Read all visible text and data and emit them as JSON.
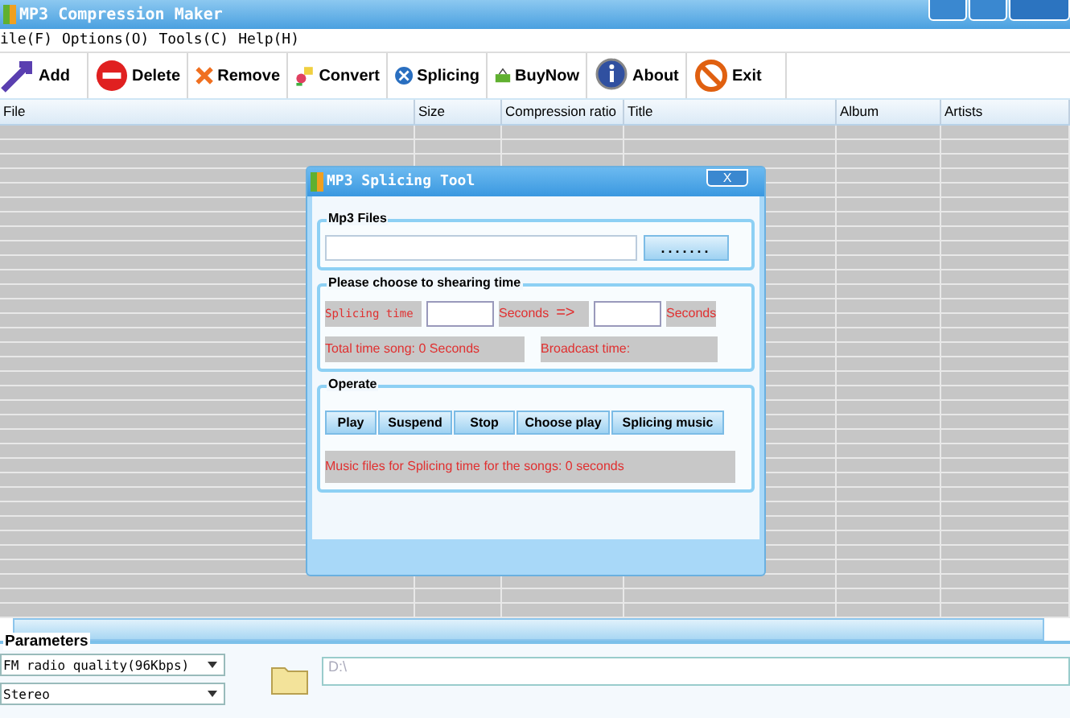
{
  "window": {
    "title": "MP3 Compression Maker"
  },
  "menu": [
    "ile(F)",
    "Options(O)",
    "Tools(C)",
    "Help(H)"
  ],
  "toolbar": [
    {
      "label": "Add",
      "kind": "add"
    },
    {
      "label": "Delete",
      "kind": "delete"
    },
    {
      "label": "Remove",
      "kind": "remove"
    },
    {
      "label": "Convert",
      "kind": "convert"
    },
    {
      "label": "Splicing",
      "kind": "splicing"
    },
    {
      "label": "BuyNow",
      "kind": "buy"
    },
    {
      "label": "About",
      "kind": "about"
    },
    {
      "label": "Exit",
      "kind": "exit"
    }
  ],
  "table": {
    "columns": [
      "File",
      "Size",
      "Compression ratio",
      "Title",
      "Album",
      "Artists"
    ]
  },
  "dialog": {
    "title": "MP3 Splicing Tool",
    "close": "X",
    "files_group": {
      "title": "Mp3 Files",
      "browse": "......."
    },
    "time_group": {
      "title": "Please choose to shearing time",
      "splicing_time": "Splicing time",
      "seconds_1": "Seconds",
      "arrow": "=>",
      "seconds_2": "Seconds",
      "total": "Total time song: 0 Seconds",
      "broadcast": "Broadcast time:"
    },
    "operate_group": {
      "title": "Operate",
      "buttons": [
        "Play",
        "Suspend",
        "Stop",
        "Choose play",
        "Splicing music"
      ],
      "message": "Music files for Splicing  time for the songs: 0 seconds"
    }
  },
  "parameters": {
    "title": "Parameters",
    "quality": "FM radio quality(96Kbps)",
    "channel": "Stereo",
    "path": "D:\\"
  }
}
